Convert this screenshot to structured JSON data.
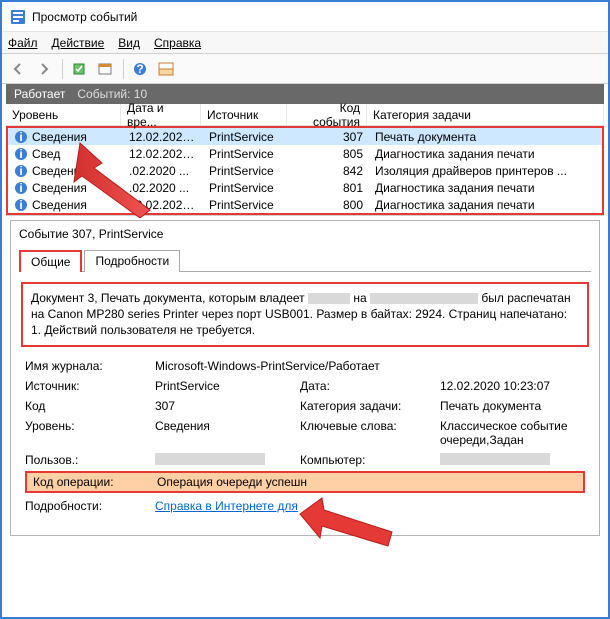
{
  "window": {
    "title": "Просмотр событий"
  },
  "menu": {
    "file": "Файл",
    "action": "Действие",
    "view": "Вид",
    "help": "Справка"
  },
  "strip": {
    "status": "Работает",
    "count_label": "Событий: 10"
  },
  "columns": {
    "level": "Уровень",
    "date": "Дата и вре...",
    "source": "Источник",
    "code": "Код события",
    "category": "Категория задачи"
  },
  "rows": [
    {
      "level": "Сведения",
      "date": "12.02.2020 ...",
      "source": "PrintService",
      "code": "307",
      "category": "Печать документа",
      "selected": true
    },
    {
      "level": "Свед",
      "date": "12.02.2020 ...",
      "source": "PrintService",
      "code": "805",
      "category": "Диагностика задания печати"
    },
    {
      "level": "Сведени",
      "date": ".02.2020 ...",
      "source": "PrintService",
      "code": "842",
      "category": "Изоляция драйверов принтеров ..."
    },
    {
      "level": "Сведения",
      "date": ".02.2020 ...",
      "source": "PrintService",
      "code": "801",
      "category": "Диагностика задания печати"
    },
    {
      "level": "Сведения",
      "date": "12.02.2020 ...",
      "source": "PrintService",
      "code": "800",
      "category": "Диагностика задания печати"
    }
  ],
  "event": {
    "header": "Событие 307, PrintService",
    "tabs": {
      "general": "Общие",
      "details": "Подробности"
    },
    "desc_p1": "Документ 3, Печать документа, которым владеет",
    "desc_p2": "на",
    "desc_p3": "был распечатан на Canon MP280 series Printer через порт USB001.  Размер в байтах: 2924. Страниц напечатано: 1. Действий пользователя не требуется.",
    "fields": {
      "journal_lbl": "Имя журнала:",
      "journal_val": "Microsoft-Windows-PrintService/Работает",
      "source_lbl": "Источник:",
      "source_val": "PrintService",
      "date_lbl": "Дата:",
      "date_val": "12.02.2020 10:23:07",
      "code_lbl": "Код",
      "code_val": "307",
      "taskcat_lbl": "Категория задачи:",
      "taskcat_val": "Печать документа",
      "level_lbl": "Уровень:",
      "level_val": "Сведения",
      "keywords_lbl": "Ключевые слова:",
      "keywords_val": "Классическое событие очереди,Задан",
      "user_lbl": "Пользов.:",
      "computer_lbl": "Компьютер:",
      "opcode_lbl": "Код операции:",
      "opcode_val": "Операция очереди успешн",
      "details_lbl": "Подробности:",
      "details_link": "Справка в Интернете для "
    }
  },
  "icons": {
    "app": "event-viewer-icon",
    "back": "back-icon",
    "fwd": "forward-icon",
    "props": "properties-icon",
    "refresh": "refresh-icon",
    "help": "help-icon",
    "pane": "preview-pane-icon"
  }
}
